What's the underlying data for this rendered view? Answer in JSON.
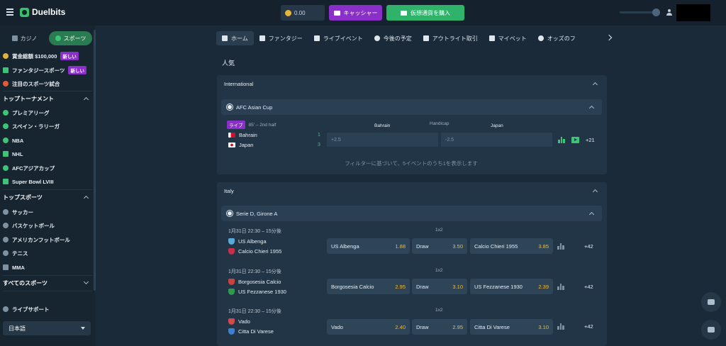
{
  "header": {
    "brand": "Duelbits",
    "balance": "0.00",
    "cashier_label": "キャッシャー",
    "buy_crypto_label": "仮想通貨を購入"
  },
  "sidebar": {
    "casino_label": "カジノ",
    "sports_label": "スポーツ",
    "promos": [
      {
        "label": "賞金総額 $100,000",
        "badge": "新しい"
      },
      {
        "label": "ファンタジースポーツ",
        "badge": "新しい"
      },
      {
        "label": "注目のスポーツ試合",
        "badge": ""
      }
    ],
    "top_tournaments_title": "トップトーナメント",
    "tournaments": [
      "プレミアリーグ",
      "スペイン・ラリーガ",
      "NBA",
      "NHL",
      "AFCアジアカップ",
      "Super Bowl LVIII"
    ],
    "top_sports_title": "トップスポーツ",
    "sports": [
      "サッカー",
      "バスケットボール",
      "アメリカンフットボール",
      "テニス",
      "MMA"
    ],
    "all_sports_title": "すべてのスポーツ",
    "live_support_label": "ライブサポート",
    "language": "日本語"
  },
  "nav": {
    "tabs": [
      "ホーム",
      "ファンタジー",
      "ライブイベント",
      "今後の予定",
      "アウトライト取引",
      "マイベット",
      "オッズのフ"
    ]
  },
  "main": {
    "section_title": "人気",
    "international": {
      "title": "International",
      "league": "AFC Asian Cup",
      "live_label": "ライブ",
      "status": "85' – 2nd half",
      "col_home": "Bahrain",
      "col_market": "Handicap",
      "col_away": "Japan",
      "home_team": "Bahrain",
      "away_team": "Japan",
      "home_score": "1",
      "away_score": "3",
      "home_line": "+2.5",
      "away_line": "-2.5",
      "more": "+21",
      "filter_note": "フィルターに基づいて、5イベントのうち1を表示します"
    },
    "italy": {
      "title": "Italy",
      "league": "Serie D, Girone A",
      "matches": [
        {
          "time": "1月31日 22:30 – 15分後",
          "market": "1x2",
          "home": "US Albenga",
          "away": "Calcio Chieri 1955",
          "o1": "1.88",
          "draw_label": "Draw",
          "ox": "3.50",
          "o2": "3.85",
          "more": "+42"
        },
        {
          "time": "1月31日 22:30 – 15分後",
          "market": "1x2",
          "home": "Borgosesia Calcio",
          "away": "US Fezzanese 1930",
          "o1": "2.95",
          "draw_label": "Draw",
          "ox": "3.10",
          "o2": "2.39",
          "more": "+42"
        },
        {
          "time": "1月31日 22:30 – 15分後",
          "market": "1x2",
          "home": "Vado",
          "away": "Citta Di Varese",
          "o1": "2.40",
          "draw_label": "Draw",
          "ox": "2.95",
          "o2": "3.10",
          "more": "+42"
        }
      ]
    }
  }
}
